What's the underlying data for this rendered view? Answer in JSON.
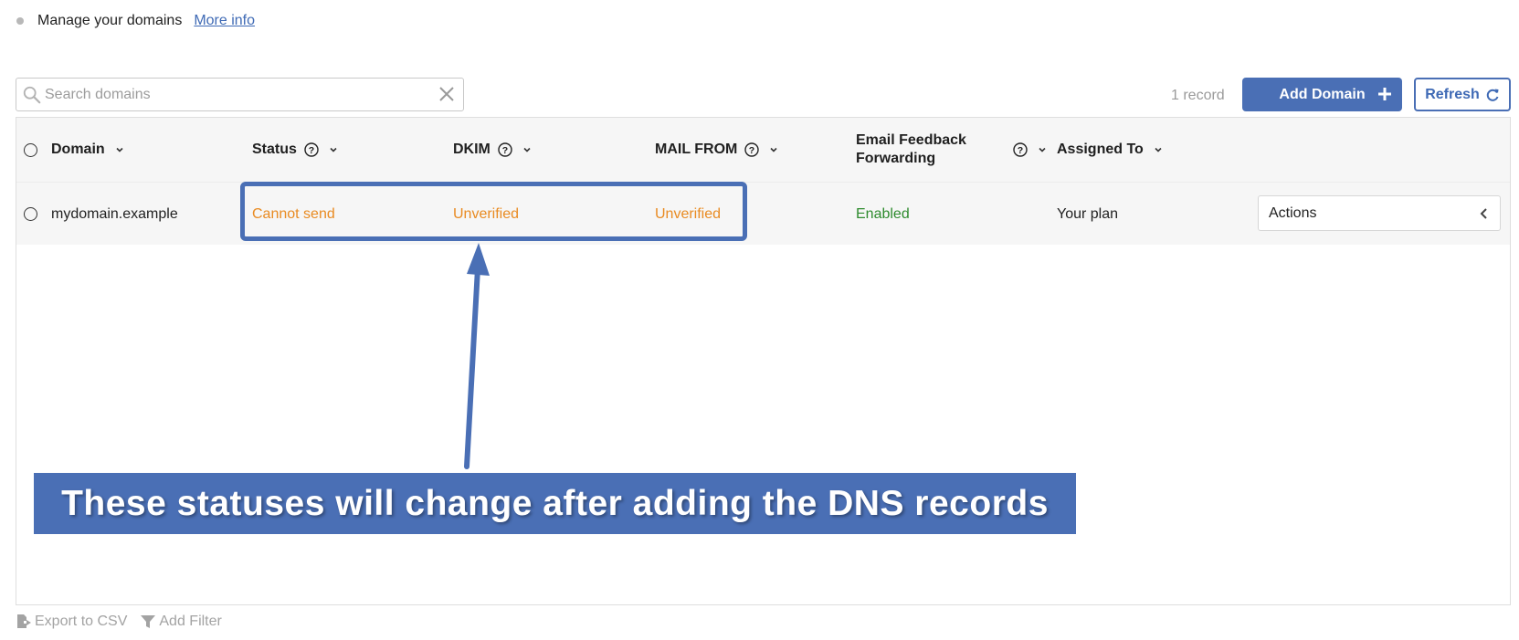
{
  "header": {
    "manage_text": "Manage your domains",
    "more_info_link": "More info"
  },
  "toolbar": {
    "search_placeholder": "Search domains",
    "record_count": "1 record",
    "add_domain_label": "Add Domain",
    "refresh_label": "Refresh"
  },
  "table": {
    "columns": [
      {
        "label": "Domain"
      },
      {
        "label": "Status"
      },
      {
        "label": "DKIM"
      },
      {
        "label": "MAIL FROM"
      },
      {
        "label": "Email Feedback Forwarding"
      },
      {
        "label": "Assigned To"
      }
    ],
    "rows": [
      {
        "domain": "mydomain.example",
        "status": "Cannot send",
        "dkim": "Unverified",
        "mail_from": "Unverified",
        "feedback_forwarding": "Enabled",
        "assigned_to": "Your plan",
        "actions_label": "Actions"
      }
    ]
  },
  "annotation": {
    "banner_text": "These statuses will change after adding the DNS records"
  },
  "footer": {
    "export_label": "Export to CSV",
    "filter_label": "Add Filter"
  },
  "colors": {
    "accent": "#4a6fb5",
    "warning": "#e98b22",
    "success": "#2e8b2e",
    "muted": "#a3a3a3"
  }
}
